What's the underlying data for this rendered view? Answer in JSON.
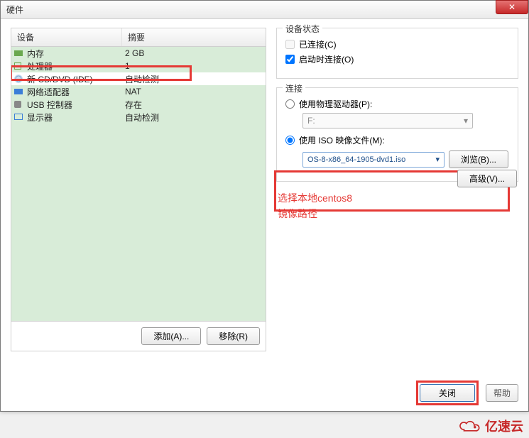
{
  "window": {
    "title": "硬件"
  },
  "device_table": {
    "header_device": "设备",
    "header_summary": "摘要",
    "rows": [
      {
        "name": "内存",
        "summary": "2 GB"
      },
      {
        "name": "处理器",
        "summary": "1"
      },
      {
        "name": "新 CD/DVD (IDE)",
        "summary": "自动检测"
      },
      {
        "name": "网络适配器",
        "summary": "NAT"
      },
      {
        "name": "USB 控制器",
        "summary": "存在"
      },
      {
        "name": "显示器",
        "summary": "自动检测"
      }
    ]
  },
  "left_buttons": {
    "add": "添加(A)...",
    "remove": "移除(R)"
  },
  "status_group": {
    "title": "设备状态",
    "connected": "已连接(C)",
    "connect_on_start": "启动时连接(O)"
  },
  "connection_group": {
    "title": "连接",
    "use_physical": "使用物理驱动器(P):",
    "drive_value": "F:",
    "use_iso": "使用 ISO 映像文件(M):",
    "iso_value": "OS-8-x86_64-1905-dvd1.iso",
    "browse": "浏览(B)..."
  },
  "annotation": {
    "line1": "选择本地centos8",
    "line2": "镜像路径"
  },
  "advanced": "高级(V)...",
  "footer": {
    "close": "关闭",
    "help": "帮助"
  },
  "watermark": "亿速云"
}
